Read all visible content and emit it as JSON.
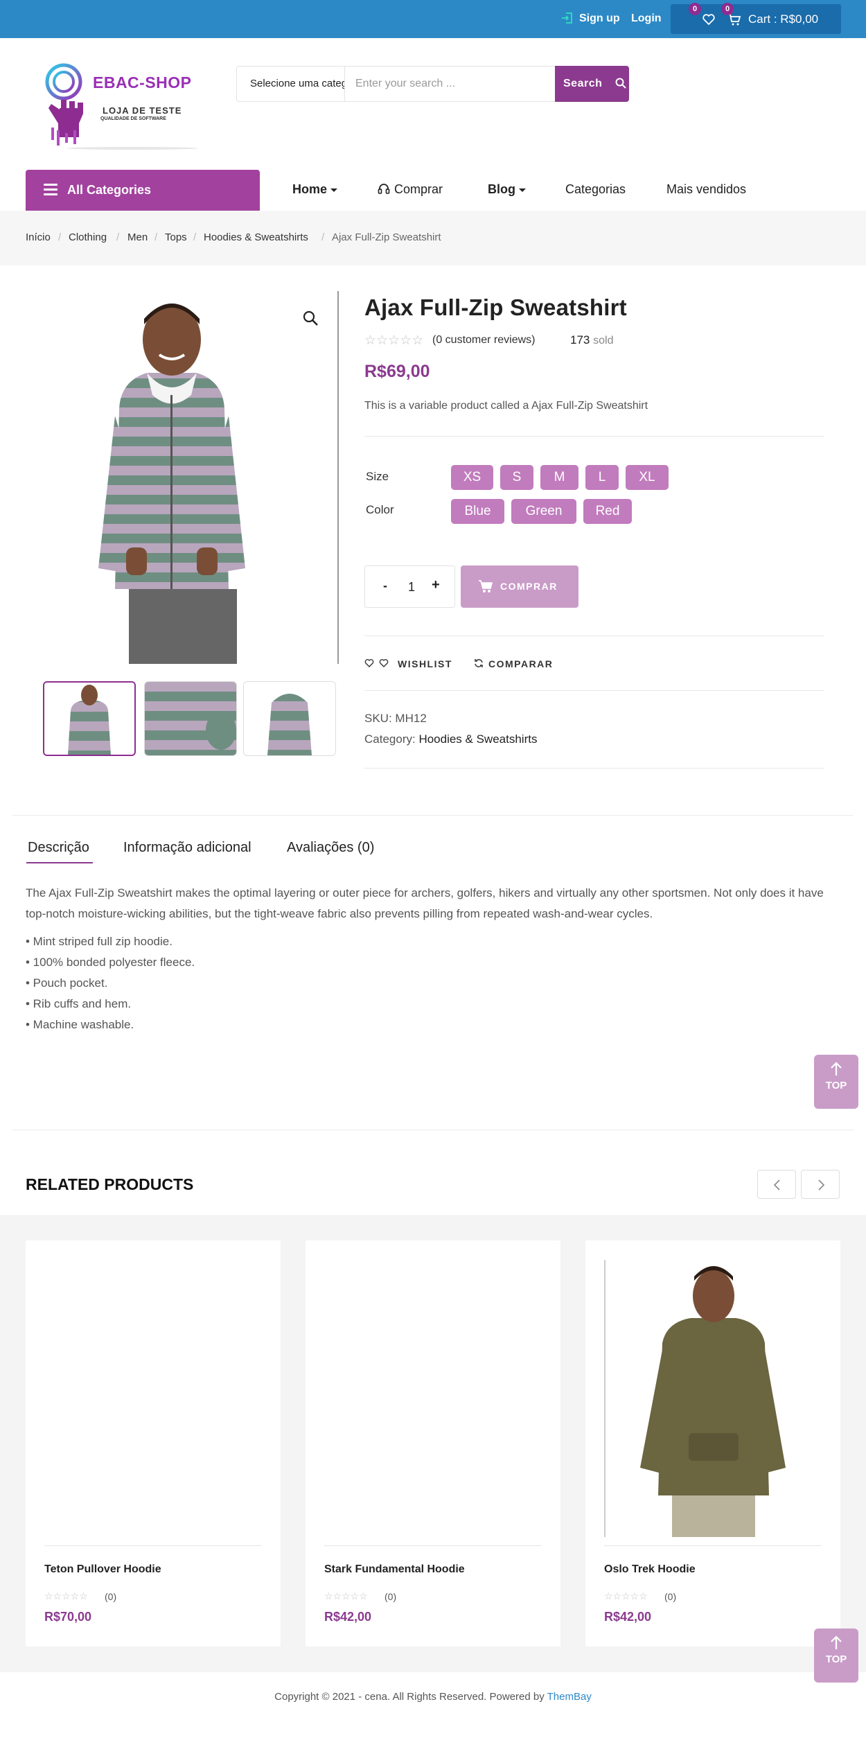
{
  "topbar": {
    "signup": "Sign up",
    "login": "Login",
    "wishlist_count": "0",
    "cart_count": "0",
    "cart_label": "Cart : R$0,00"
  },
  "logo": {
    "title": "EBAC-SHOP",
    "subtitle": "LOJA DE TESTE",
    "tagline": "QUALIDADE DE SOFTWARE"
  },
  "search": {
    "category": "Selecione uma categoria",
    "placeholder": "Enter your search ...",
    "button": "Search"
  },
  "nav": {
    "all_categories": "All Categories",
    "items": [
      "Home",
      "Comprar",
      "Blog",
      "Categorias",
      "Mais vendidos"
    ]
  },
  "breadcrumb": [
    "Início",
    "Clothing",
    "Men",
    "Tops",
    "Hoodies & Sweatshirts",
    "Ajax Full-Zip Sweatshirt"
  ],
  "product": {
    "title": "Ajax Full-Zip Sweatshirt",
    "rating": 0,
    "reviews": "(0 customer reviews)",
    "sold_count": "173",
    "sold_label": "sold",
    "price": "R$69,00",
    "short_description": "This is a variable product called a Ajax Full-Zip Sweatshirt",
    "size_label": "Size",
    "sizes": [
      "XS",
      "S",
      "M",
      "L",
      "XL"
    ],
    "color_label": "Color",
    "colors": [
      "Blue",
      "Green",
      "Red"
    ],
    "quantity": "1",
    "qty_minus": "-",
    "qty_plus": "+",
    "buy_button": "COMPRAR",
    "wishlist": "WISHLIST",
    "compare": "COMPARAR",
    "sku_label": "SKU:",
    "sku": "MH12",
    "category_label": "Category:",
    "category": "Hoodies & Sweatshirts",
    "swatch_color": "#c17cbd",
    "accent_color": "#8b3a8f"
  },
  "tabs": [
    "Descrição",
    "Informação adicional",
    "Avaliações (0)"
  ],
  "description": {
    "text": "The Ajax Full-Zip Sweatshirt makes the optimal layering or outer piece for archers, golfers, hikers and virtually any other sportsmen. Not only does it have top-notch moisture-wicking abilities, but the tight-weave fabric also prevents pilling from repeated wash-and-wear cycles.",
    "bullets": [
      "• Mint striped full zip hoodie.",
      "• 100% bonded polyester fleece.",
      "• Pouch pocket.",
      "• Rib cuffs and hem.",
      "• Machine washable."
    ]
  },
  "top_button": "TOP",
  "related": {
    "title": "RELATED PRODUCTS",
    "products": [
      {
        "name": "Teton Pullover Hoodie",
        "count": "(0)",
        "price": "R$70,00"
      },
      {
        "name": "Stark Fundamental Hoodie",
        "count": "(0)",
        "price": "R$42,00"
      },
      {
        "name": "Oslo Trek Hoodie",
        "count": "(0)",
        "price": "R$42,00"
      }
    ]
  },
  "footer": {
    "text": "Copyright © 2021 - cena. All Rights Reserved. Powered by",
    "brand": "ThemBay"
  }
}
